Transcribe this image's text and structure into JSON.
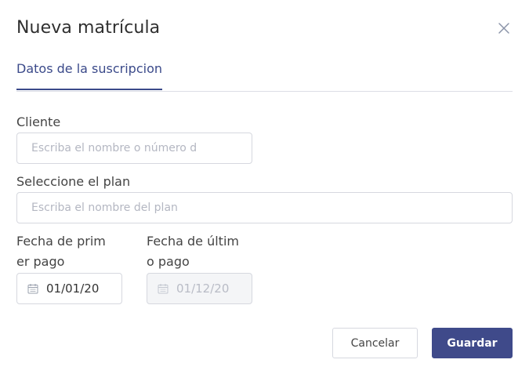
{
  "modal": {
    "title": "Nueva matrícula",
    "close_icon": "close-icon"
  },
  "tabs": [
    {
      "label": "Datos de la suscripcion",
      "active": true
    }
  ],
  "form": {
    "client": {
      "label": "Cliente",
      "placeholder": "Escriba el nombre o número d",
      "value": ""
    },
    "plan": {
      "label": "Seleccione el plan",
      "placeholder": "Escriba el nombre del plan",
      "value": ""
    },
    "first_payment": {
      "label_line1": "Fecha de prim",
      "label_line2": "er pago",
      "value": "01/01/20",
      "icon": "calendar-icon",
      "disabled": false
    },
    "last_payment": {
      "label_line1": "Fecha de últim",
      "label_line2": "o pago",
      "value": "01/12/20",
      "icon": "calendar-icon",
      "disabled": true
    }
  },
  "actions": {
    "cancel_label": "Cancelar",
    "save_label": "Guardar"
  },
  "colors": {
    "primary": "#3f4a8a",
    "border": "#d6d8df",
    "placeholder": "#b4b7c2"
  }
}
